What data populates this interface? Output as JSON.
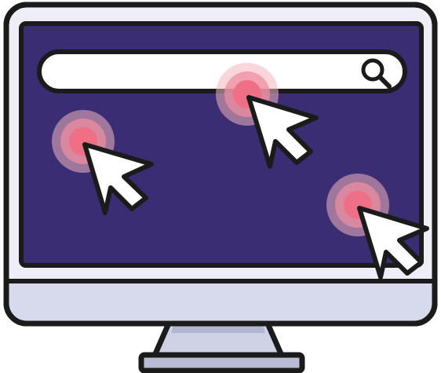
{
  "illustration": {
    "subject": "desktop-monitor",
    "screen_color": "#3b2d73",
    "bezel_color": "#eeeef6",
    "chin_color": "#d7d9ec",
    "stand_color": "#cfd2e4",
    "outline_color": "#1b1b1b",
    "click_ring_outer": "#f3b4bf",
    "click_ring_inner": "#ee6f86",
    "cursor_fill": "#ffffff"
  },
  "search": {
    "placeholder": "",
    "icon": "search-icon"
  },
  "cursors": [
    {
      "icon": "cursor-arrow-icon",
      "state": "clicking"
    },
    {
      "icon": "cursor-arrow-icon",
      "state": "clicking"
    },
    {
      "icon": "cursor-arrow-icon",
      "state": "clicking"
    }
  ]
}
